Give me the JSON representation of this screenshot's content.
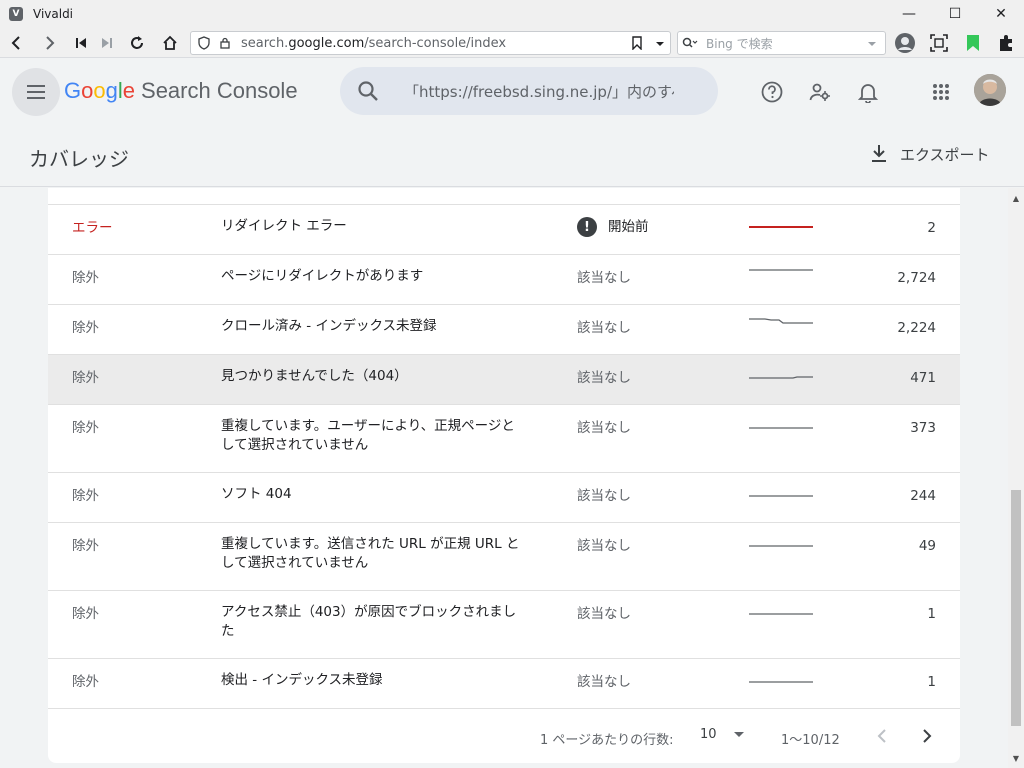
{
  "window": {
    "title": "Vivaldi",
    "icon_letter": "V"
  },
  "browser": {
    "url_prefix": "search.",
    "url_host": "google.com",
    "url_path": "/search-console/index",
    "search_placeholder": "Bing で検索"
  },
  "app": {
    "logo": [
      "G",
      "o",
      "o",
      "g",
      "l",
      "e"
    ],
    "product": "Search Console",
    "search_value": "「https://freebsd.sing.ne.jp/」内のすべてのURLを検査"
  },
  "page": {
    "title": "カバレッジ",
    "export_label": "エクスポート"
  },
  "table": {
    "rows": [
      {
        "type": "エラー",
        "reason": "リダイレクト エラー",
        "validation": "開始前",
        "count": "2",
        "spark": "red-flat",
        "error": true
      },
      {
        "type": "除外",
        "reason": "ページにリダイレクトがあります",
        "validation": "該当なし",
        "count": "2,724",
        "spark": "high"
      },
      {
        "type": "除外",
        "reason": "クロール済み - インデックス未登録",
        "validation": "該当なし",
        "count": "2,224",
        "spark": "step-down"
      },
      {
        "type": "除外",
        "reason": "見つかりませんでした（404）",
        "validation": "該当なし",
        "count": "471",
        "spark": "step-up",
        "highlight": true
      },
      {
        "type": "除外",
        "reason": "重複しています。ユーザーにより、正規ページとして選択されていません",
        "validation": "該当なし",
        "count": "373",
        "spark": "flat"
      },
      {
        "type": "除外",
        "reason": "ソフト 404",
        "validation": "該当なし",
        "count": "244",
        "spark": "flat"
      },
      {
        "type": "除外",
        "reason": "重複しています。送信された URL が正規 URL として選択されていません",
        "validation": "該当なし",
        "count": "49",
        "spark": "flat"
      },
      {
        "type": "除外",
        "reason": "アクセス禁止（403）が原因でブロックされました",
        "validation": "該当なし",
        "count": "1",
        "spark": "flat"
      },
      {
        "type": "除外",
        "reason": "検出 - インデックス未登録",
        "validation": "該当なし",
        "count": "1",
        "spark": "flat"
      }
    ]
  },
  "pager": {
    "rows_label": "1 ページあたりの行数:",
    "rows_value": "10",
    "range": "1〜10/12"
  },
  "colors": {
    "error": "#c5221f",
    "spark_error": "#c5221f",
    "spark_normal": "#5f6368",
    "highlight_row": "#ebebeb"
  }
}
